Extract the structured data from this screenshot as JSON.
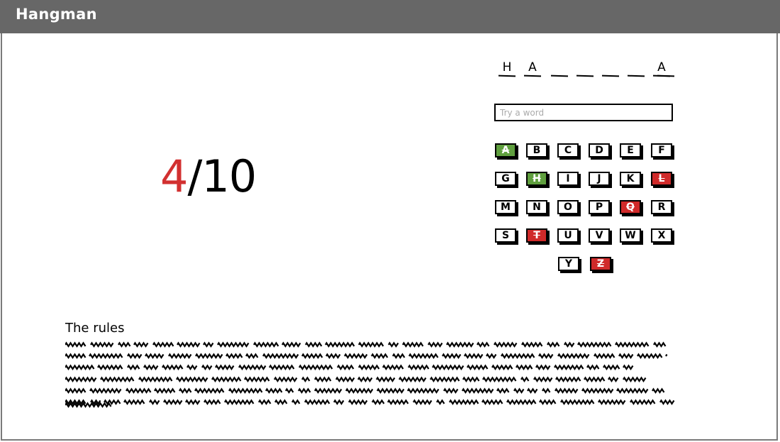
{
  "window": {
    "title": "Hangman"
  },
  "score": {
    "current": "4",
    "separator": "/",
    "total": "10"
  },
  "word": {
    "slots": [
      {
        "letter": "H"
      },
      {
        "letter": "A"
      },
      {
        "letter": ""
      },
      {
        "letter": ""
      },
      {
        "letter": ""
      },
      {
        "letter": ""
      },
      {
        "letter": "A"
      },
      {
        "letter": ""
      }
    ]
  },
  "guess_input": {
    "placeholder": "Try a word",
    "value": ""
  },
  "keyboard": {
    "keys": [
      {
        "letter": "A",
        "state": "correct"
      },
      {
        "letter": "B",
        "state": "unused"
      },
      {
        "letter": "C",
        "state": "unused"
      },
      {
        "letter": "D",
        "state": "unused"
      },
      {
        "letter": "E",
        "state": "unused"
      },
      {
        "letter": "F",
        "state": "unused"
      },
      {
        "letter": "G",
        "state": "unused"
      },
      {
        "letter": "H",
        "state": "correct"
      },
      {
        "letter": "I",
        "state": "unused"
      },
      {
        "letter": "J",
        "state": "unused"
      },
      {
        "letter": "K",
        "state": "unused"
      },
      {
        "letter": "L",
        "state": "wrong"
      },
      {
        "letter": "M",
        "state": "unused"
      },
      {
        "letter": "N",
        "state": "unused"
      },
      {
        "letter": "O",
        "state": "unused"
      },
      {
        "letter": "P",
        "state": "unused"
      },
      {
        "letter": "Q",
        "state": "wrong"
      },
      {
        "letter": "R",
        "state": "unused"
      },
      {
        "letter": "S",
        "state": "unused"
      },
      {
        "letter": "T",
        "state": "wrong"
      },
      {
        "letter": "U",
        "state": "unused"
      },
      {
        "letter": "V",
        "state": "unused"
      },
      {
        "letter": "W",
        "state": "unused"
      },
      {
        "letter": "X",
        "state": "unused"
      },
      {
        "letter": "Y",
        "state": "unused"
      },
      {
        "letter": "Z",
        "state": "wrong"
      }
    ]
  },
  "rules": {
    "title": "The rules"
  },
  "colors": {
    "correct": "#5f9f3e",
    "wrong": "#d02a2a",
    "titlebar": "#676767",
    "score_current": "#d23030"
  }
}
